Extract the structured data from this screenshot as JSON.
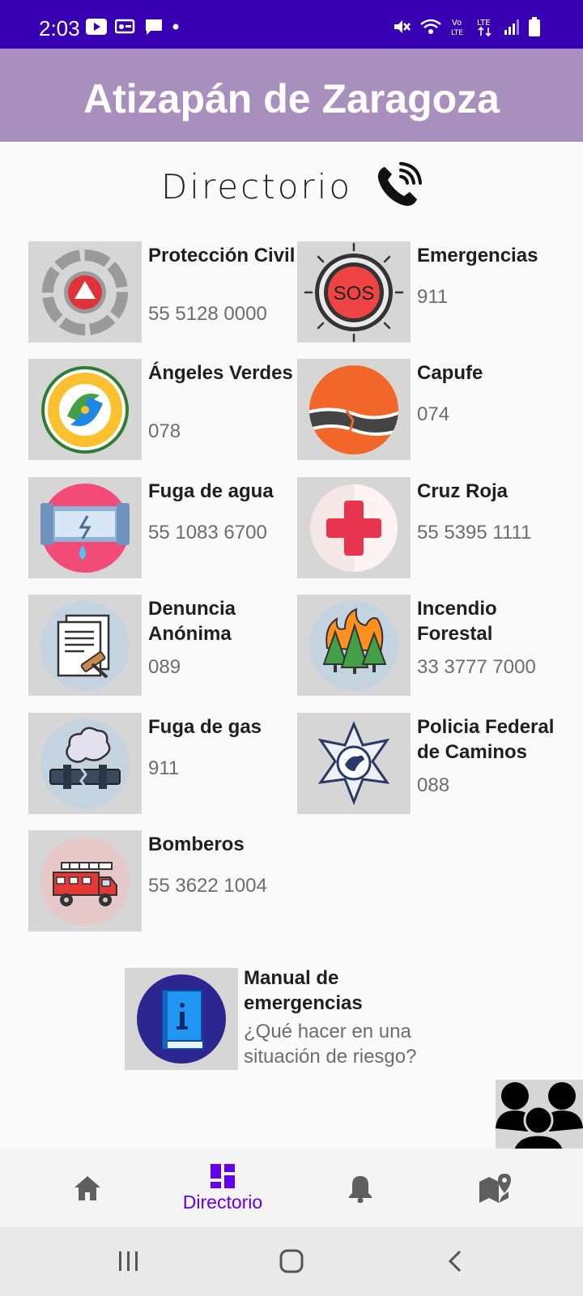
{
  "status": {
    "time": "2:03"
  },
  "app": {
    "title": "Atizapán de Zaragoza"
  },
  "directory": {
    "heading": "Directorio"
  },
  "contacts": [
    {
      "name": "Protección Civil",
      "phone": "55 5128 0000",
      "icon": "proteccion-civil-icon"
    },
    {
      "name": "Emergencias",
      "phone": "911",
      "icon": "sos-icon"
    },
    {
      "name": "Ángeles Verdes",
      "phone": "078",
      "icon": "angeles-verdes-icon"
    },
    {
      "name": "Capufe",
      "phone": "074",
      "icon": "road-icon"
    },
    {
      "name": "Fuga de agua",
      "phone": "55 1083 6700",
      "icon": "water-leak-icon"
    },
    {
      "name": "Cruz Roja",
      "phone": "55 5395 1111",
      "icon": "red-cross-icon"
    },
    {
      "name": "Denuncia Anónima",
      "phone": "089",
      "icon": "anonymous-report-icon"
    },
    {
      "name": "Incendio Forestal",
      "phone": "33 3777 7000",
      "icon": "forest-fire-icon"
    },
    {
      "name": "Fuga de gas",
      "phone": "911",
      "icon": "gas-leak-icon"
    },
    {
      "name": "Policia Federal de Caminos",
      "phone": "088",
      "icon": "police-star-icon"
    },
    {
      "name": "Bomberos",
      "phone": "55 3622 1004",
      "icon": "fire-truck-icon"
    }
  ],
  "manual": {
    "title": "Manual de emergencias",
    "subtitle": "¿Qué hacer en una situación de riesgo?"
  },
  "bottom_nav": {
    "directorio_label": "Directorio",
    "active": "directorio"
  },
  "colors": {
    "status_bar": "#3700b3",
    "app_bar": "#a98fbd",
    "accent": "#6200ee"
  }
}
